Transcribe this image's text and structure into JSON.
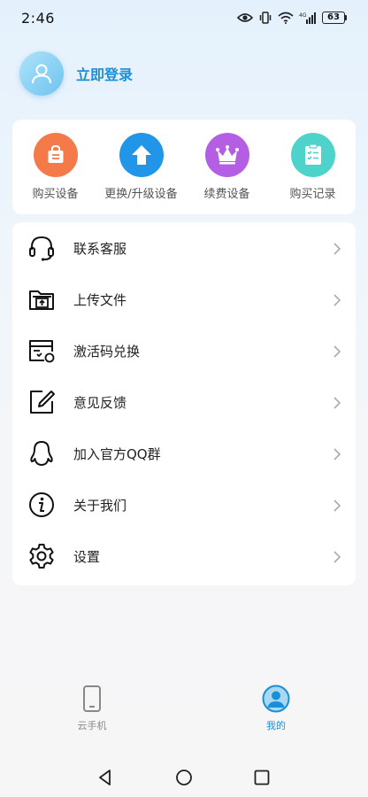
{
  "status_bar": {
    "time": "2:46",
    "battery": "63",
    "network": "4G"
  },
  "profile": {
    "login_label": "立即登录",
    "avatar_icon": "user-icon"
  },
  "quick_actions": [
    {
      "label": "购买设备",
      "icon": "shopping-bag-icon",
      "color": "#f47a4a"
    },
    {
      "label": "更换/升级设备",
      "icon": "upload-arrow-icon",
      "color": "#2196e8"
    },
    {
      "label": "续费设备",
      "icon": "crown-icon",
      "color": "#b45fe3"
    },
    {
      "label": "购买记录",
      "icon": "clipboard-checklist-icon",
      "color": "#4dd3c9"
    }
  ],
  "menu": [
    {
      "label": "联系客服",
      "icon": "headset-icon"
    },
    {
      "label": "上传文件",
      "icon": "folder-upload-icon"
    },
    {
      "label": "激活码兑换",
      "icon": "ticket-exchange-icon"
    },
    {
      "label": "意见反馈",
      "icon": "edit-pencil-icon"
    },
    {
      "label": "加入官方QQ群",
      "icon": "qq-penguin-icon"
    },
    {
      "label": "关于我们",
      "icon": "info-icon"
    },
    {
      "label": "设置",
      "icon": "gear-icon"
    }
  ],
  "tabs": [
    {
      "label": "云手机",
      "icon": "phone-icon",
      "active": false
    },
    {
      "label": "我的",
      "icon": "user-profile-icon",
      "active": true
    }
  ],
  "colors": {
    "accent": "#1a8fd8"
  }
}
